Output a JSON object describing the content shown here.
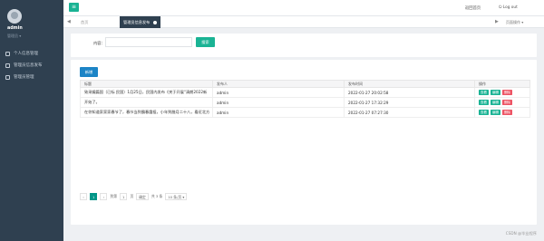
{
  "sidebar": {
    "user_name": "admin",
    "user_role": "管理员 ▾",
    "items": [
      {
        "label": "个人信息管理",
        "icon": "user-card-icon"
      },
      {
        "label": "管理员信息发布",
        "icon": "edit-icon"
      },
      {
        "label": "管理员管理",
        "icon": "user-icon"
      }
    ]
  },
  "topbar": {
    "menu_icon": "≡",
    "home_link": "返回首页",
    "logout_link": "⏻ Log out"
  },
  "tabs": {
    "prev": "◀",
    "next": "▶",
    "home": "首页",
    "active": "管理员信息发布",
    "close_ops": "页面操作 ▾"
  },
  "search": {
    "label": "内容：",
    "placeholder": "",
    "button": "搜索"
  },
  "toolbar": {
    "add_label": "新增"
  },
  "table": {
    "columns": [
      "标题",
      "发布人",
      "发布时间",
      "操作"
    ],
    "rows": [
      {
        "title": "致采编篇国（已标 民国）1月25日，民国内发布《关于开展“清朗2022新",
        "publisher": "admin",
        "time": "2022-01-27 20:02:58"
      },
      {
        "title": "开始了。",
        "publisher": "admin",
        "time": "2022-01-27 17:32:29"
      },
      {
        "title": "在你知道家家家春节了，春节当到霸春霞祖，小年到腊月二十八，看近北方",
        "publisher": "admin",
        "time": "2022-01-27 07:27:30"
      }
    ],
    "actions": {
      "view": "查看",
      "edit": "编辑",
      "delete": "删除"
    }
  },
  "pager": {
    "prev": "‹",
    "current": "1",
    "next": "›",
    "goto_label": "到第",
    "page_value": "1",
    "page_unit": "页",
    "confirm": "确定",
    "total": "共 3 条",
    "per_page": "10 条/页 ▾"
  },
  "watermark": "CSDN @毕业程序"
}
